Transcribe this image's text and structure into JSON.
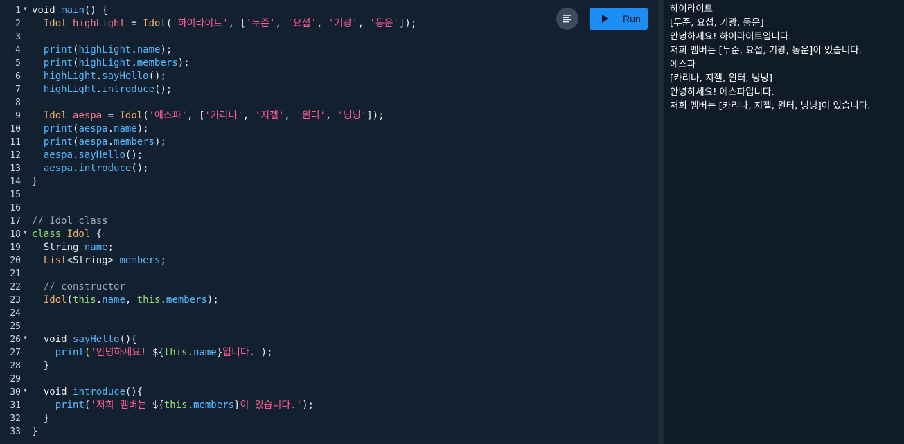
{
  "toolbar": {
    "format_icon": "format-align-icon",
    "run_label": "Run",
    "run_icon": "play-icon"
  },
  "colors": {
    "editor_bg": "#132030",
    "console_bg": "#0f1b27",
    "run_button": "#1b8df5",
    "string": "#ff5c91",
    "type": "#f2b36b",
    "function": "#53b9ff",
    "this_keyword": "#8fe07a",
    "comment": "#9aa8b7"
  },
  "editor": {
    "folded_lines": [
      1,
      18,
      26,
      30
    ],
    "lines": [
      [
        [
          "kw",
          "void "
        ],
        [
          "fn",
          "main"
        ],
        [
          "plain",
          "() {"
        ]
      ],
      [
        [
          "plain",
          "  "
        ],
        [
          "type",
          "Idol "
        ],
        [
          "var",
          "highLight"
        ],
        [
          "plain",
          " = "
        ],
        [
          "type",
          "Idol"
        ],
        [
          "plain",
          "("
        ],
        [
          "str",
          "'하이라이트'"
        ],
        [
          "plain",
          ", ["
        ],
        [
          "str",
          "'두준'"
        ],
        [
          "plain",
          ", "
        ],
        [
          "str",
          "'요섭'"
        ],
        [
          "plain",
          ", "
        ],
        [
          "str",
          "'기광'"
        ],
        [
          "plain",
          ", "
        ],
        [
          "str",
          "'동운'"
        ],
        [
          "plain",
          "]);"
        ]
      ],
      [],
      [
        [
          "plain",
          "  "
        ],
        [
          "fn",
          "print"
        ],
        [
          "plain",
          "("
        ],
        [
          "fn",
          "highLight"
        ],
        [
          "plain",
          "."
        ],
        [
          "prop",
          "name"
        ],
        [
          "plain",
          ");"
        ]
      ],
      [
        [
          "plain",
          "  "
        ],
        [
          "fn",
          "print"
        ],
        [
          "plain",
          "("
        ],
        [
          "fn",
          "highLight"
        ],
        [
          "plain",
          "."
        ],
        [
          "prop",
          "members"
        ],
        [
          "plain",
          ");"
        ]
      ],
      [
        [
          "plain",
          "  "
        ],
        [
          "fn",
          "highLight"
        ],
        [
          "plain",
          "."
        ],
        [
          "fn",
          "sayHello"
        ],
        [
          "plain",
          "();"
        ]
      ],
      [
        [
          "plain",
          "  "
        ],
        [
          "fn",
          "highLight"
        ],
        [
          "plain",
          "."
        ],
        [
          "fn",
          "introduce"
        ],
        [
          "plain",
          "();"
        ]
      ],
      [],
      [
        [
          "plain",
          "  "
        ],
        [
          "type",
          "Idol "
        ],
        [
          "var",
          "aespa"
        ],
        [
          "plain",
          " = "
        ],
        [
          "type",
          "Idol"
        ],
        [
          "plain",
          "("
        ],
        [
          "str",
          "'에스파'"
        ],
        [
          "plain",
          ", ["
        ],
        [
          "str",
          "'카리나'"
        ],
        [
          "plain",
          ", "
        ],
        [
          "str",
          "'지젤'"
        ],
        [
          "plain",
          ", "
        ],
        [
          "str",
          "'윈터'"
        ],
        [
          "plain",
          ", "
        ],
        [
          "str",
          "'닝닝'"
        ],
        [
          "plain",
          "]);"
        ]
      ],
      [
        [
          "plain",
          "  "
        ],
        [
          "fn",
          "print"
        ],
        [
          "plain",
          "("
        ],
        [
          "fn",
          "aespa"
        ],
        [
          "plain",
          "."
        ],
        [
          "prop",
          "name"
        ],
        [
          "plain",
          ");"
        ]
      ],
      [
        [
          "plain",
          "  "
        ],
        [
          "fn",
          "print"
        ],
        [
          "plain",
          "("
        ],
        [
          "fn",
          "aespa"
        ],
        [
          "plain",
          "."
        ],
        [
          "prop",
          "members"
        ],
        [
          "plain",
          ");"
        ]
      ],
      [
        [
          "plain",
          "  "
        ],
        [
          "fn",
          "aespa"
        ],
        [
          "plain",
          "."
        ],
        [
          "fn",
          "sayHello"
        ],
        [
          "plain",
          "();"
        ]
      ],
      [
        [
          "plain",
          "  "
        ],
        [
          "fn",
          "aespa"
        ],
        [
          "plain",
          "."
        ],
        [
          "fn",
          "introduce"
        ],
        [
          "plain",
          "();"
        ]
      ],
      [
        [
          "plain",
          "}"
        ]
      ],
      [],
      [],
      [
        [
          "comment",
          "// Idol class"
        ]
      ],
      [
        [
          "kwc",
          "class "
        ],
        [
          "type",
          "Idol"
        ],
        [
          "plain",
          " {"
        ]
      ],
      [
        [
          "plain",
          "  "
        ],
        [
          "kw",
          "String "
        ],
        [
          "prop",
          "name"
        ],
        [
          "plain",
          ";"
        ]
      ],
      [
        [
          "plain",
          "  "
        ],
        [
          "type",
          "List"
        ],
        [
          "plain",
          "<String> "
        ],
        [
          "prop",
          "members"
        ],
        [
          "plain",
          ";"
        ]
      ],
      [],
      [
        [
          "plain",
          "  "
        ],
        [
          "comment",
          "// constructor"
        ]
      ],
      [
        [
          "plain",
          "  "
        ],
        [
          "type",
          "Idol"
        ],
        [
          "plain",
          "("
        ],
        [
          "this",
          "this"
        ],
        [
          "plain",
          "."
        ],
        [
          "prop",
          "name"
        ],
        [
          "plain",
          ", "
        ],
        [
          "this",
          "this"
        ],
        [
          "plain",
          "."
        ],
        [
          "prop",
          "members"
        ],
        [
          "plain",
          ");"
        ]
      ],
      [],
      [],
      [
        [
          "plain",
          "  "
        ],
        [
          "kw",
          "void "
        ],
        [
          "fn",
          "sayHello"
        ],
        [
          "plain",
          "(){"
        ]
      ],
      [
        [
          "plain",
          "    "
        ],
        [
          "fn",
          "print"
        ],
        [
          "plain",
          "("
        ],
        [
          "str",
          "'안녕하세요! "
        ],
        [
          "plain",
          "${"
        ],
        [
          "this",
          "this"
        ],
        [
          "plain",
          "."
        ],
        [
          "prop",
          "name"
        ],
        [
          "plain",
          "}"
        ],
        [
          "str",
          "입니다.'"
        ],
        [
          "plain",
          ");"
        ]
      ],
      [
        [
          "plain",
          "  }"
        ]
      ],
      [],
      [
        [
          "plain",
          "  "
        ],
        [
          "kw",
          "void "
        ],
        [
          "fn",
          "introduce"
        ],
        [
          "plain",
          "(){"
        ]
      ],
      [
        [
          "plain",
          "    "
        ],
        [
          "fn",
          "print"
        ],
        [
          "plain",
          "("
        ],
        [
          "str",
          "'저희 멤버는 "
        ],
        [
          "plain",
          "${"
        ],
        [
          "this",
          "this"
        ],
        [
          "plain",
          "."
        ],
        [
          "prop",
          "members"
        ],
        [
          "plain",
          "}"
        ],
        [
          "str",
          "이 있습니다.'"
        ],
        [
          "plain",
          ");"
        ]
      ],
      [
        [
          "plain",
          "  }"
        ]
      ],
      [
        [
          "plain",
          "}"
        ]
      ]
    ]
  },
  "console": {
    "output": [
      "하이라이트",
      "[두준, 요섭, 기광, 동운]",
      "안녕하세요! 하이라이트입니다.",
      "저희 멤버는 [두준, 요섭, 기광, 동운]이 있습니다.",
      "에스파",
      "[카리나, 지젤, 윈터, 닝닝]",
      "안녕하세요! 에스파입니다.",
      "저희 멤버는 [카리나, 지젤, 윈터, 닝닝]이 있습니다."
    ]
  }
}
